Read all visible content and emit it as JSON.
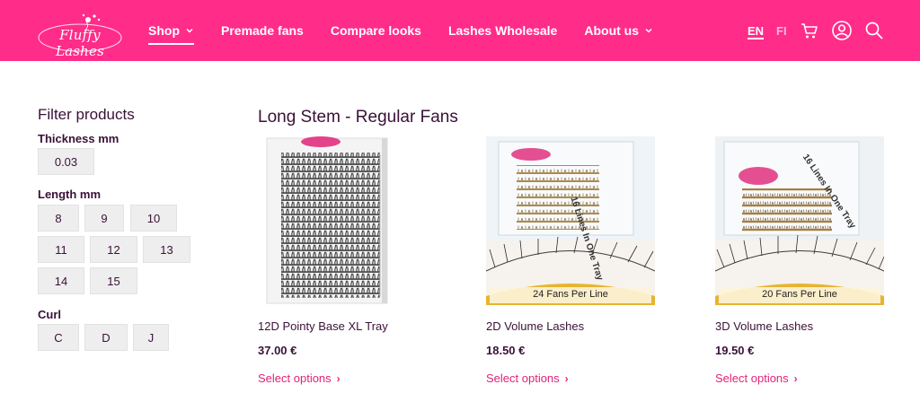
{
  "brand": {
    "logo_text": "Fluffy Lashes",
    "primary_color": "#ff2c8a",
    "accent_text_color": "#e0247a"
  },
  "nav": {
    "items": [
      {
        "label": "Shop",
        "has_dropdown": true,
        "active": true
      },
      {
        "label": "Premade fans",
        "has_dropdown": false
      },
      {
        "label": "Compare looks",
        "has_dropdown": false
      },
      {
        "label": "Lashes Wholesale",
        "has_dropdown": false
      },
      {
        "label": "About us",
        "has_dropdown": true
      }
    ],
    "lang_en": "EN",
    "lang_fi": "FI",
    "icons": [
      "cart-icon",
      "account-icon",
      "search-icon"
    ]
  },
  "filters": {
    "title": "Filter products",
    "thickness": {
      "title": "Thickness mm",
      "options": [
        "0.03"
      ]
    },
    "length": {
      "title": "Length mm",
      "options": [
        "8",
        "9",
        "10",
        "11",
        "12",
        "13",
        "14",
        "15"
      ]
    },
    "curl": {
      "title": "Curl",
      "options": [
        "C",
        "D",
        "J"
      ]
    }
  },
  "main": {
    "section_title": "Long Stem - Regular Fans",
    "products": [
      {
        "name": "12D Pointy Base XL Tray",
        "price": "37.00 €",
        "action": "Select options"
      },
      {
        "name": "2D Volume Lashes",
        "price": "18.50 €",
        "action": "Select options",
        "tray_text": "16 Lines In One Tray",
        "banner_text": "24 Fans Per Line"
      },
      {
        "name": "3D Volume Lashes",
        "price": "19.50 €",
        "action": "Select options",
        "tray_text": "16 Lines In One Tray",
        "banner_text": "20 Fans Per Line"
      }
    ]
  }
}
